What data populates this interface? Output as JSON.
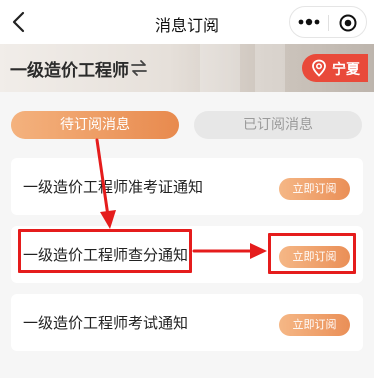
{
  "nav": {
    "title": "消息订阅",
    "back_icon": "chevron-left-icon",
    "more_icon": "more-dots-icon",
    "close_icon": "target-circle-icon"
  },
  "banner": {
    "exam": "一级造价工程师",
    "swap_icon": "swap-arrows-icon",
    "region": "宁夏",
    "region_icon": "location-pin-icon",
    "region_color": "#e94a3a"
  },
  "tabs": [
    {
      "label": "待订阅消息",
      "active": true
    },
    {
      "label": "已订阅消息",
      "active": false
    }
  ],
  "items": [
    {
      "name": "一级造价工程师准考证通知",
      "action": "立即订阅"
    },
    {
      "name": "一级造价工程师查分通知",
      "action": "立即订阅"
    },
    {
      "name": "一级造价工程师考试通知",
      "action": "立即订阅"
    }
  ],
  "colors": {
    "accent_orange": "#ea8f57",
    "highlight_red": "#e51c1c"
  }
}
